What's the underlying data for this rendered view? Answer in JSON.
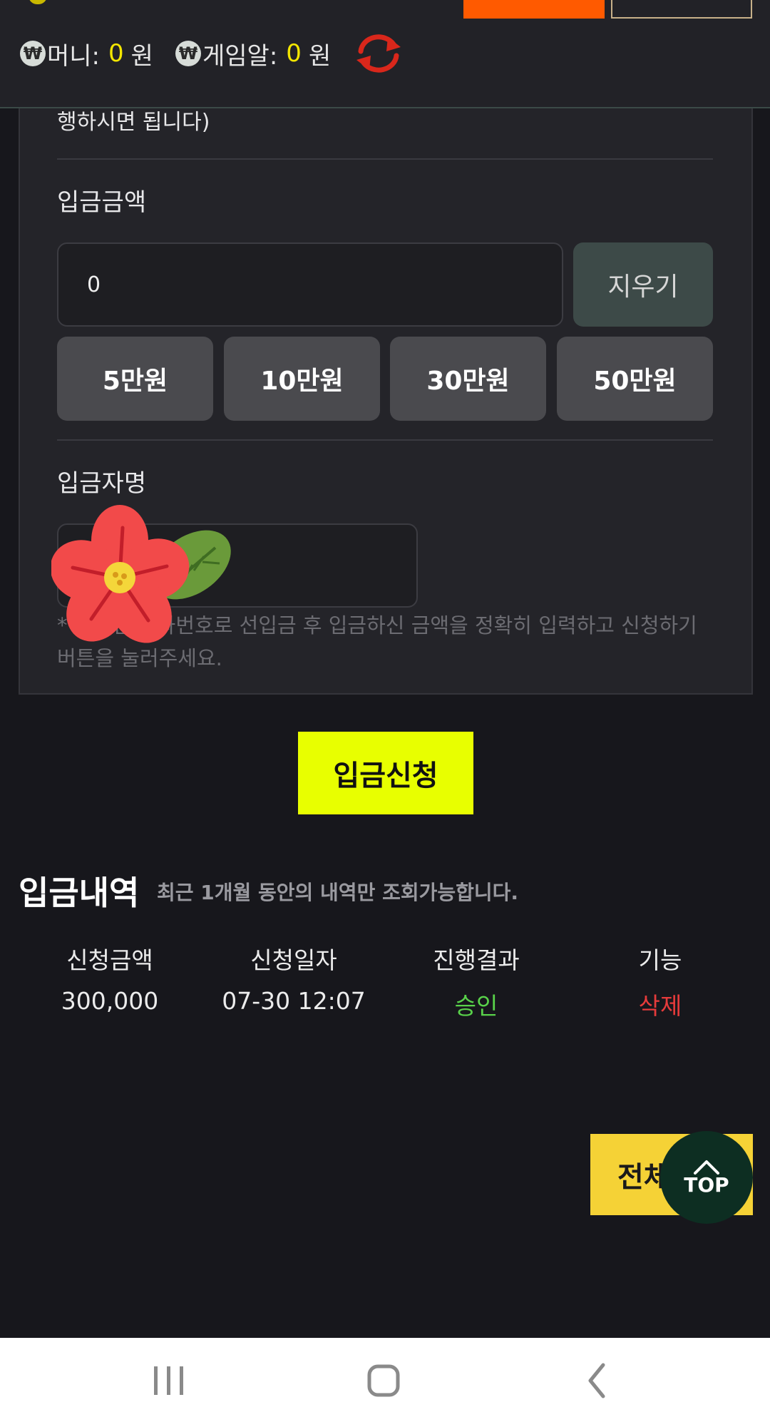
{
  "header": {
    "money_label": "머니:",
    "money_value": "0",
    "game_label": "게임알:",
    "game_value": "0",
    "currency": "원",
    "won_symbol": "₩"
  },
  "form": {
    "top_text": "행하시면 됩니다)",
    "amount_label": "입금금액",
    "amount_value": "0",
    "clear_label": "지우기",
    "presets": [
      "5만원",
      "10만원",
      "30만원",
      "50만원"
    ],
    "name_label": "입금자명",
    "name_value": "",
    "notice": "* 확인된 계좌번호로 선입금 후 입금하신 금액을 정확히 입력하고 신청하기 버튼을 눌러주세요."
  },
  "submit_label": "입금신청",
  "history": {
    "title": "입금내역",
    "subtitle": "최근 1개월 동안의 내역만 조회가능합니다.",
    "columns": [
      "신청금액",
      "신청일자",
      "진행결과",
      "기능"
    ],
    "rows": [
      {
        "amount": "300,000",
        "date": "07-30 12:07",
        "result": "승인",
        "action": "삭제"
      }
    ]
  },
  "floating": {
    "all_label": "전체",
    "top_label": "TOP"
  },
  "colors": {
    "accent_yellow": "#e8ff00",
    "approved_green": "#59d24a",
    "delete_red": "#e63b3b",
    "header_orange": "#ff5a00"
  },
  "icons": {
    "refresh": "refresh-icon",
    "sticker": "flower-sticker",
    "nav": [
      "recent-apps-icon",
      "home-icon",
      "back-icon"
    ]
  }
}
